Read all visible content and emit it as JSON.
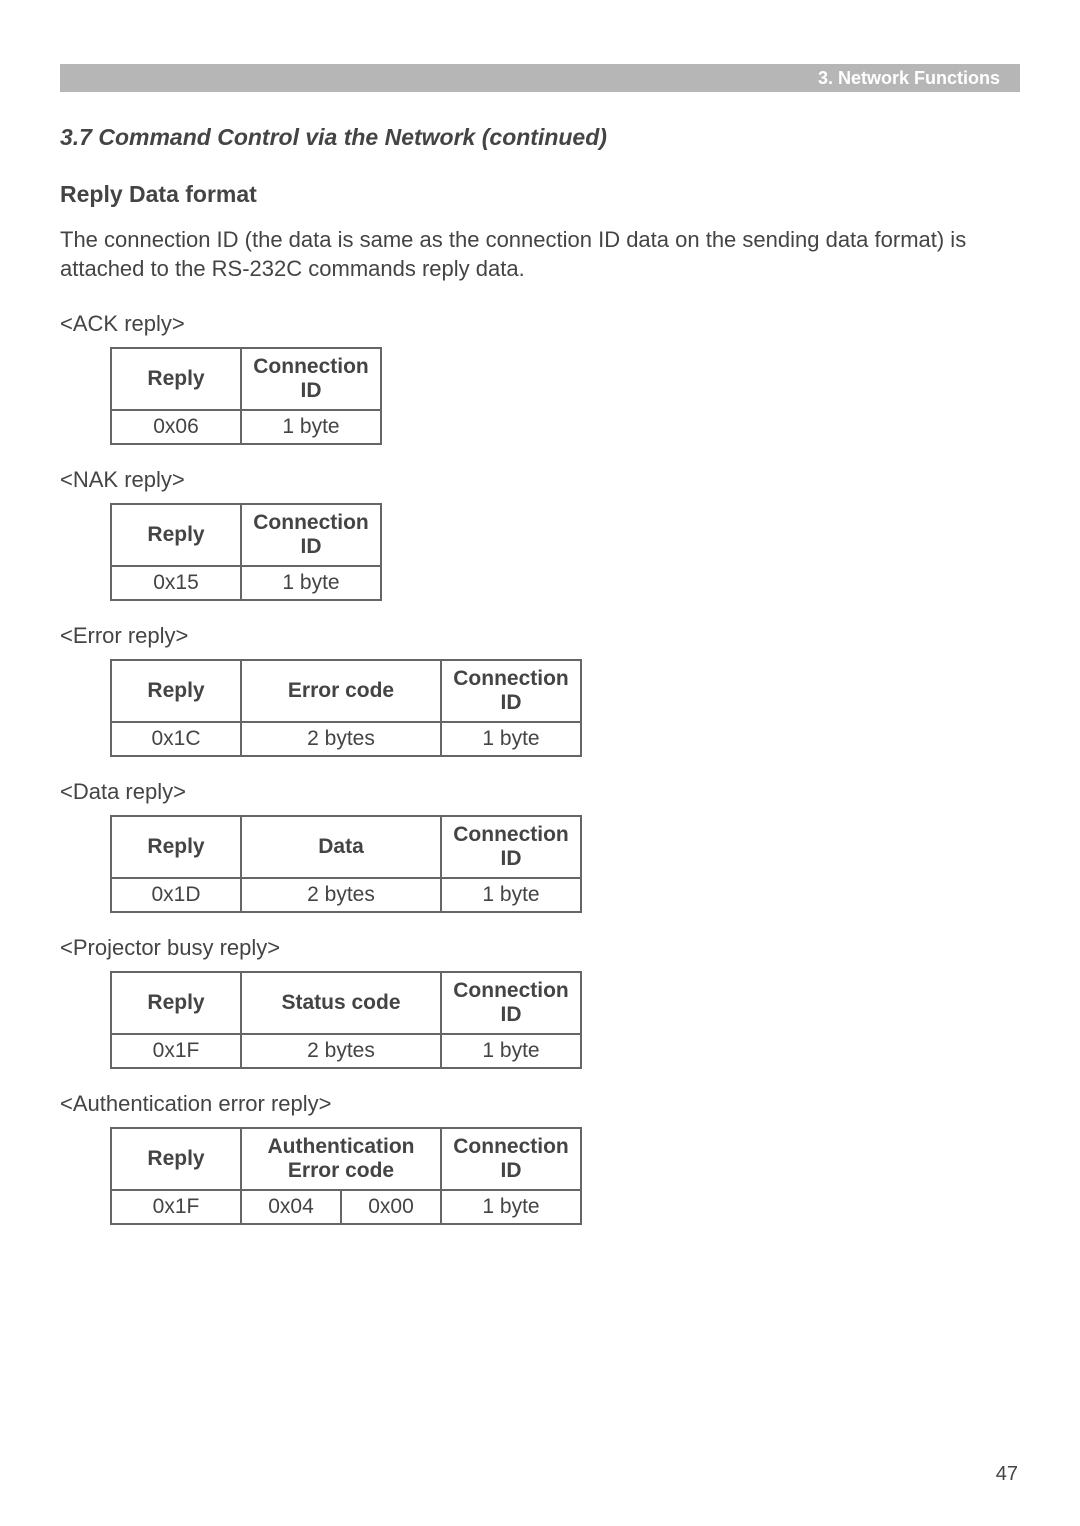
{
  "header": {
    "chapter_label": "3. Network Functions"
  },
  "section": {
    "title": "3.7 Command Control via the Network (continued)",
    "subtitle": "Reply Data format",
    "intro": "The connection ID (the data is same as the connection ID data on the sending data format) is attached to the RS-232C commands reply data."
  },
  "labels": {
    "ack": "<ACK reply>",
    "nak": "<NAK reply>",
    "err": "<Error reply>",
    "data": "<Data reply>",
    "busy": "<Projector busy reply>",
    "auth": "<Authentication error reply>"
  },
  "col": {
    "reply": "Reply",
    "conn_id": "Connection ID",
    "error_code": "Error code",
    "data": "Data",
    "status_code": "Status code",
    "auth_error_code": "Authentication Error code"
  },
  "val": {
    "ack_reply": "0x06",
    "nak_reply": "0x15",
    "err_reply": "0x1C",
    "data_reply": "0x1D",
    "busy_reply": "0x1F",
    "auth_reply": "0x1F",
    "auth_b1": "0x04",
    "auth_b2": "0x00",
    "one_byte": "1 byte",
    "two_bytes": "2 bytes"
  },
  "page_number": "47"
}
